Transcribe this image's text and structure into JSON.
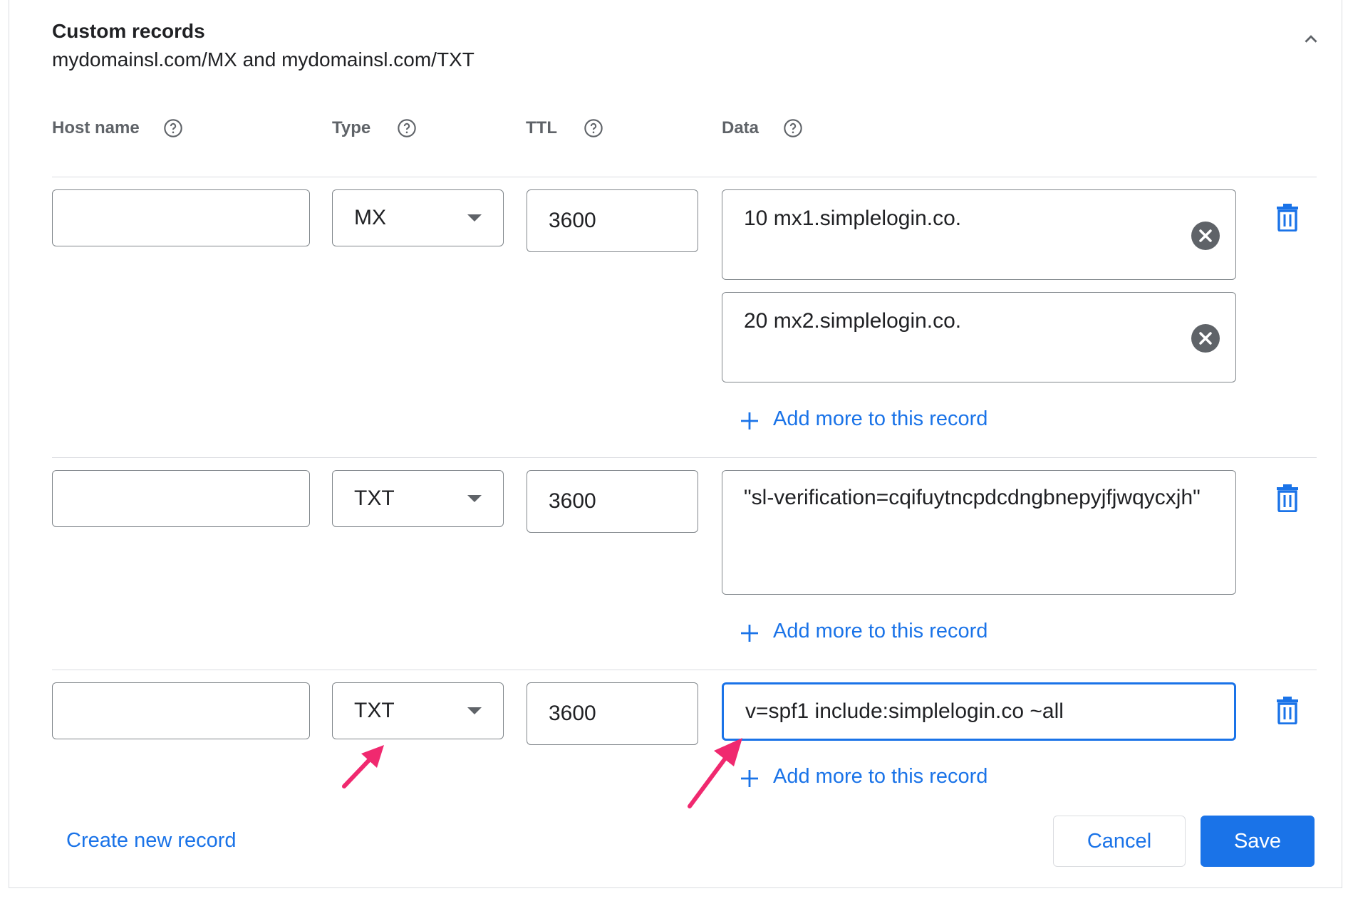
{
  "header": {
    "title": "Custom records",
    "subtitle": "mydomainsl.com/MX and mydomainsl.com/TXT"
  },
  "columns": {
    "host": "Host name",
    "type": "Type",
    "ttl": "TTL",
    "data": "Data"
  },
  "records": [
    {
      "host": "",
      "type": "MX",
      "ttl": "3600",
      "data": [
        "10 mx1.simplelogin.co.",
        "20 mx2.simplelogin.co."
      ]
    },
    {
      "host": "",
      "type": "TXT",
      "ttl": "3600",
      "data": [
        "\"sl-verification=cqifuytncpdcdngbnepyjfjwqycxjh\""
      ]
    },
    {
      "host": "",
      "type": "TXT",
      "ttl": "3600",
      "data": [
        "v=spf1 include:simplelogin.co ~all"
      ]
    }
  ],
  "add_more_label": "Add more to this record",
  "footer": {
    "create": "Create new record",
    "cancel": "Cancel",
    "save": "Save"
  },
  "colors": {
    "accent": "#1a73e8",
    "annotation_arrow": "#f0296f",
    "border": "#80868b",
    "icon_gray": "#5f6368"
  }
}
